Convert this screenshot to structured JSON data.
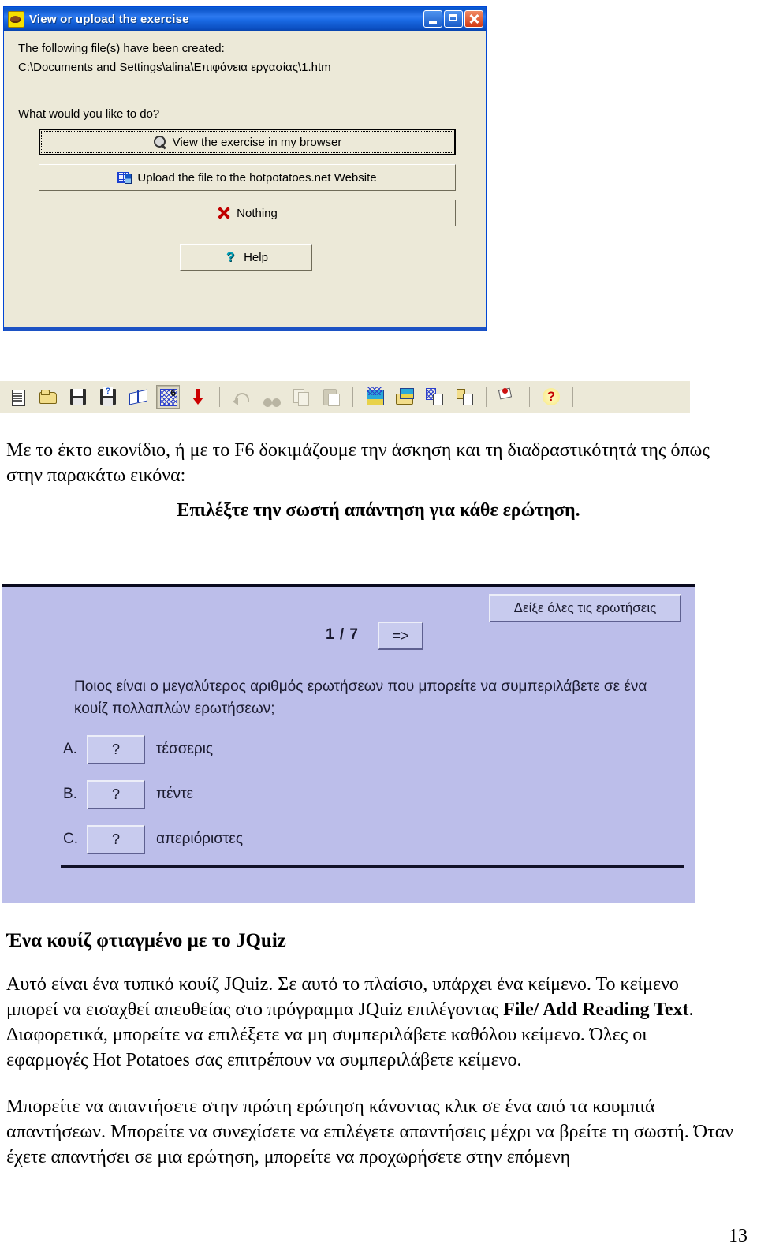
{
  "dialog": {
    "title": "View or upload the exercise",
    "icon": "hot-potatoes-icon",
    "window_buttons": {
      "minimize": "_",
      "maximize": "□",
      "close": "✕"
    },
    "created_label": "The following file(s) have been created:",
    "created_path": "C:\\Documents and Settings\\alina\\Επιφάνεια εργασίας\\1.htm",
    "prompt": "What would you like to do?",
    "buttons": [
      {
        "id": "view-in-browser",
        "label": "View the exercise in my browser",
        "accel": "V",
        "icon": "magnifier-icon",
        "focused": true
      },
      {
        "id": "upload-hotpotatoes",
        "label": "Upload the file to the hotpotatoes.net Website",
        "accel": "U",
        "icon": "web-upload-icon",
        "focused": false
      },
      {
        "id": "nothing",
        "label": "Nothing",
        "accel": "N",
        "icon": "red-x-icon",
        "focused": false
      }
    ],
    "help_button": {
      "label": "Help",
      "accel": "H",
      "icon": "question-mark-icon"
    }
  },
  "toolbar": {
    "items": [
      {
        "name": "new-document-icon",
        "glyph": "g-new",
        "active": false,
        "disabled": false
      },
      {
        "name": "open-folder-icon",
        "glyph": "g-open",
        "active": false,
        "disabled": false
      },
      {
        "name": "save-icon",
        "glyph": "g-save",
        "active": false,
        "disabled": false
      },
      {
        "name": "save-as-icon",
        "glyph": "g-saveas",
        "active": false,
        "disabled": false
      },
      {
        "name": "book-icon",
        "glyph": "g-book",
        "active": false,
        "disabled": false
      },
      {
        "name": "export-web-f6-icon",
        "glyph": "g-f6",
        "active": true,
        "disabled": false
      },
      {
        "name": "red-down-arrow-icon",
        "glyph": "g-arrow",
        "active": false,
        "disabled": false
      },
      {
        "name": "separator",
        "glyph": "sep",
        "active": false,
        "disabled": false
      },
      {
        "name": "undo-icon",
        "glyph": "g-undo",
        "active": false,
        "disabled": true
      },
      {
        "name": "cut-icon",
        "glyph": "g-cut",
        "active": false,
        "disabled": true
      },
      {
        "name": "copy-icon",
        "glyph": "g-copy",
        "active": false,
        "disabled": true
      },
      {
        "name": "paste-icon",
        "glyph": "g-paste",
        "active": false,
        "disabled": true
      },
      {
        "name": "separator",
        "glyph": "sep",
        "active": false,
        "disabled": false
      },
      {
        "name": "insert-picture-icon",
        "glyph": "g-pic",
        "active": false,
        "disabled": false
      },
      {
        "name": "picture-from-file-icon",
        "glyph": "g-picopen",
        "active": false,
        "disabled": false
      },
      {
        "name": "insert-web-link-icon",
        "glyph": "g-link",
        "active": false,
        "disabled": false
      },
      {
        "name": "insert-local-link-icon",
        "glyph": "g-link2",
        "active": false,
        "disabled": false
      },
      {
        "name": "separator",
        "glyph": "sep",
        "active": false,
        "disabled": false
      },
      {
        "name": "colors-icon",
        "glyph": "g-color",
        "active": false,
        "disabled": false
      },
      {
        "name": "separator",
        "glyph": "sep",
        "active": false,
        "disabled": false
      },
      {
        "name": "help-icon",
        "glyph": "g-help",
        "active": false,
        "disabled": false
      },
      {
        "name": "separator",
        "glyph": "sep",
        "active": false,
        "disabled": false
      }
    ]
  },
  "document": {
    "intro_line1": "Με το έκτο εικονίδιο, ή με το F6 δοκιμάζουμε την άσκηση και τη διαδραστικότητά της",
    "intro_line2": "όπως στην παρακάτω εικόνα:",
    "heading_centered": "Επιλέξτε την σωστή απάντηση για κάθε ερώτηση.",
    "heading2": "Ένα κουίζ φτιαγμένο με το JQuiz",
    "para2_a": "Αυτό είναι ένα τυπικό κουίζ JQuiz. Σε αυτό το πλαίσιο, υπάρχει ένα κείμενο. Το κείμενο μπορεί να εισαχθεί απευθείας στο πρόγραμμα JQuiz  επιλέγοντας ",
    "para2_bold": "File/ Add Reading Text",
    "para2_b": ". Διαφορετικά, μπορείτε να επιλέξετε να μη συμπεριλάβετε καθόλου κείμενο. Όλες οι εφαρμογές Hot Potatoes σας επιτρέπουν να συμπεριλάβετε κείμενο.",
    "para3": "Μπορείτε να απαντήσετε στην πρώτη ερώτηση κάνοντας κλικ σε ένα από τα κουμπιά απαντήσεων. Μπορείτε να συνεχίσετε να επιλέγετε απαντήσεις μέχρι να βρείτε τη σωστή. Όταν έχετε απαντήσει σε μια ερώτηση, μπορείτε να προχωρήσετε στην επόμενη",
    "page_number": "13"
  },
  "quiz": {
    "show_all_button": "Δείξε όλες τις ερωτήσεις",
    "counter": "1 / 7",
    "next_button": "=>",
    "question": "Ποιος είναι ο μεγαλύτερος αριθμός ερωτήσεων που μπορείτε να συμπεριλάβετε σε ένα κουίζ πολλαπλών ερωτήσεων;",
    "options": [
      {
        "letter": "A.",
        "button": "?",
        "label": "τέσσερις"
      },
      {
        "letter": "B.",
        "button": "?",
        "label": "πέντε"
      },
      {
        "letter": "C.",
        "button": "?",
        "label": "απεριόριστες"
      }
    ]
  },
  "colors": {
    "titlebar_blue": "#1a6ae4",
    "dialog_face": "#ece9d8",
    "quiz_background": "#bcbeea",
    "quiz_button_face": "#c8cbee",
    "accent_red": "#cc0000"
  }
}
